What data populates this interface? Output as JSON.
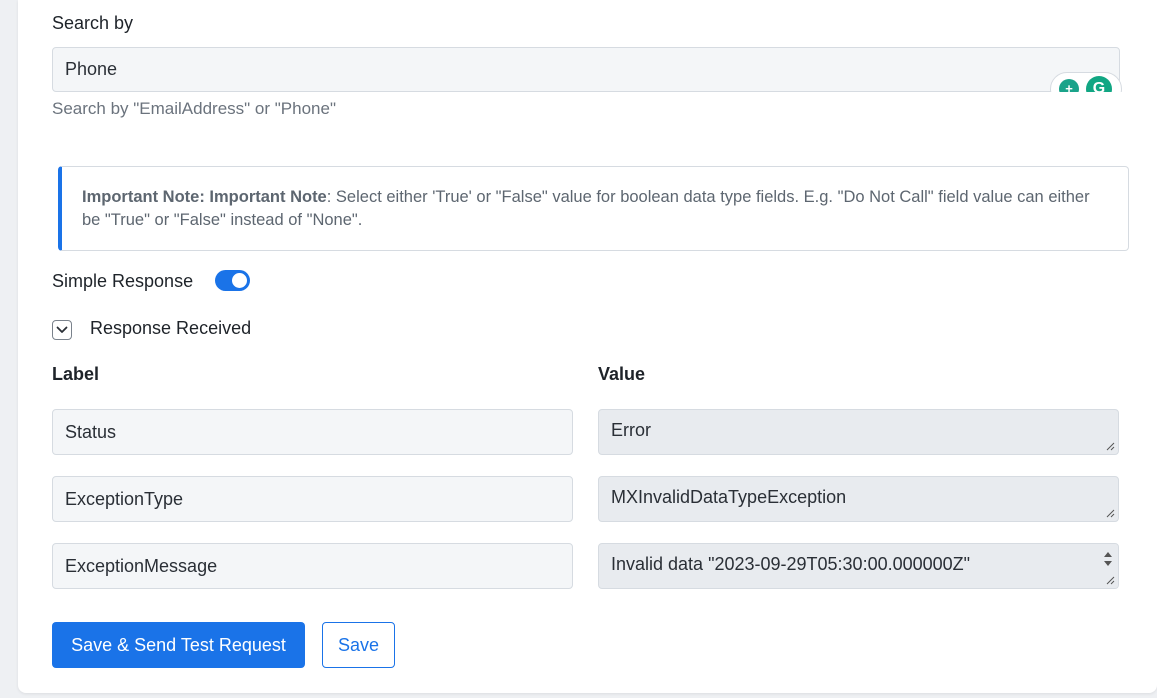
{
  "search": {
    "label": "Search by",
    "value": "Phone",
    "helper": "Search by \"EmailAddress\" or \"Phone\""
  },
  "note": {
    "bold": "Important Note: Important Note",
    "text": ": Select either 'True' or \"False\" value for boolean data type fields. E.g. \"Do Not Call\" field value can either be \"True\" or \"False\" instead of \"None\"."
  },
  "simple_response": {
    "label": "Simple Response",
    "enabled": true
  },
  "response": {
    "title": "Response Received",
    "label_header": "Label",
    "value_header": "Value",
    "rows": [
      {
        "label": "Status",
        "value": "Error"
      },
      {
        "label": "ExceptionType",
        "value": "MXInvalidDataTypeException"
      },
      {
        "label": "ExceptionMessage",
        "value": "Invalid data \"2023-09-29T05:30:00.000000Z\""
      }
    ]
  },
  "buttons": {
    "save_send": "Save & Send Test Request",
    "save": "Save"
  },
  "colors": {
    "accent": "#1a73e8",
    "grammarly": "#11a683"
  },
  "icons": {
    "chevron": "chevron-down-icon",
    "grammarly": "grammarly-icon"
  }
}
